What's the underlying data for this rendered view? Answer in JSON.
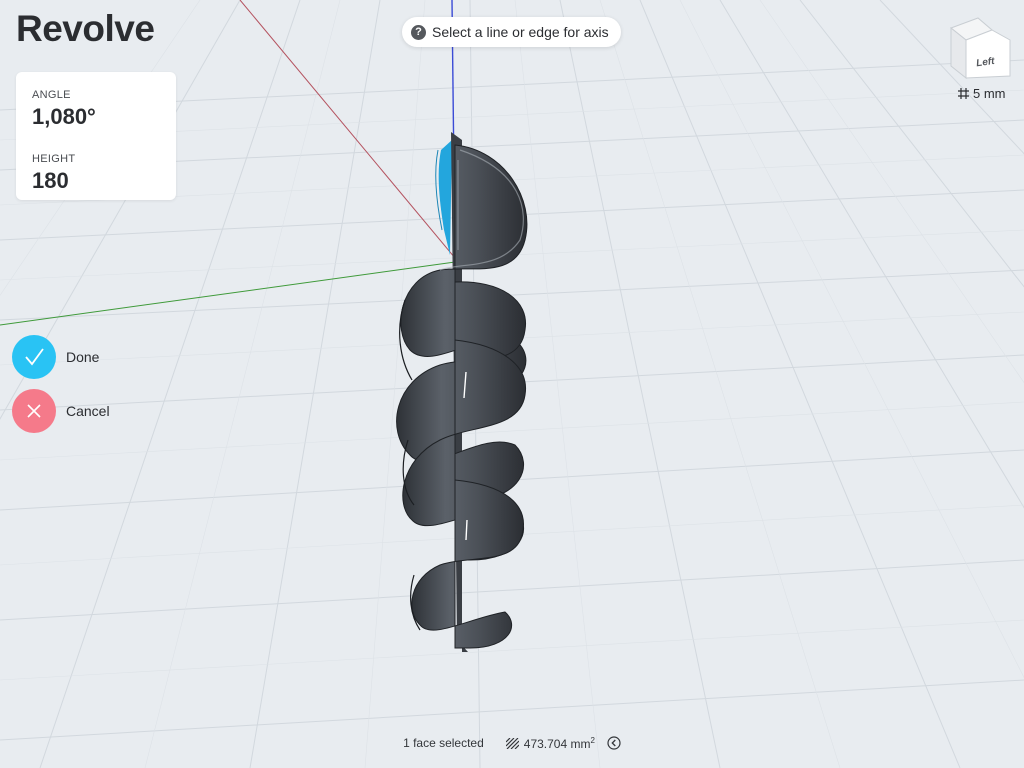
{
  "app": {
    "title": "Revolve"
  },
  "parameters": {
    "angle_label": "ANGLE",
    "angle_value": "1,080°",
    "height_label": "HEIGHT",
    "height_value": "180"
  },
  "hint": {
    "icon": "question-icon",
    "text": "Select a line or edge for axis"
  },
  "viewcube": {
    "face_label": "Left"
  },
  "grid": {
    "icon": "grid-hash-icon",
    "size": "5 mm"
  },
  "actions": {
    "done_label": "Done",
    "cancel_label": "Cancel"
  },
  "status": {
    "selection": "1 face selected",
    "area_icon": "hatch-area-icon",
    "area_value": "473.704 mm",
    "area_unit_sup": "2",
    "toggle_icon": "chevron-left-circle-icon"
  },
  "colors": {
    "background": "#e7ebef",
    "grid_line": "#d0d6dc",
    "axis_red": "#b4525f",
    "axis_green": "#3f9a3a",
    "axis_blue": "#3b4bd6",
    "done": "#29c3f4",
    "cancel": "#f57a8a",
    "model_body": "#4a4f56",
    "profile_highlight": "#23a6dd"
  }
}
